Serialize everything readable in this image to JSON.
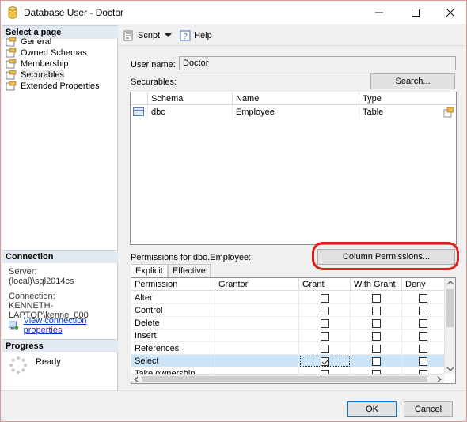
{
  "window": {
    "title": "Database User - Doctor"
  },
  "left_pane": {
    "select_page_heading": "Select a page",
    "pages": [
      {
        "label": "General"
      },
      {
        "label": "Owned Schemas"
      },
      {
        "label": "Membership"
      },
      {
        "label": "Securables",
        "selected": true
      },
      {
        "label": "Extended Properties"
      }
    ],
    "connection": {
      "heading": "Connection",
      "server_label": "Server:",
      "server_value": "(local)\\sql2014cs",
      "connection_label": "Connection:",
      "connection_value": "KENNETH-LAPTOP\\kenne_000",
      "view_link": "View connection properties"
    },
    "progress": {
      "heading": "Progress",
      "status": "Ready"
    }
  },
  "toolbar": {
    "script_label": "Script",
    "help_label": "Help"
  },
  "main": {
    "user_name_label": "User name:",
    "user_name_value": "Doctor",
    "securables_label": "Securables:",
    "search_button": "Search...",
    "securables_columns": [
      "Schema",
      "Name",
      "Type"
    ],
    "securables_rows": [
      {
        "schema": "dbo",
        "name": "Employee",
        "type": "Table"
      }
    ],
    "permissions_for_label": "Permissions for dbo.Employee:",
    "column_permissions_button": "Column Permissions...",
    "tabs": [
      "Explicit",
      "Effective"
    ],
    "active_tab": "Explicit",
    "permissions_columns": [
      "Permission",
      "Grantor",
      "Grant",
      "With Grant",
      "Deny"
    ],
    "permissions_rows": [
      {
        "permission": "Alter",
        "grantor": "",
        "grant": false,
        "with_grant": false,
        "deny": false
      },
      {
        "permission": "Control",
        "grantor": "",
        "grant": false,
        "with_grant": false,
        "deny": false
      },
      {
        "permission": "Delete",
        "grantor": "",
        "grant": false,
        "with_grant": false,
        "deny": false
      },
      {
        "permission": "Insert",
        "grantor": "",
        "grant": false,
        "with_grant": false,
        "deny": false
      },
      {
        "permission": "References",
        "grantor": "",
        "grant": false,
        "with_grant": false,
        "deny": false
      },
      {
        "permission": "Select",
        "grantor": "",
        "grant": true,
        "with_grant": false,
        "deny": false,
        "selected": true
      },
      {
        "permission": "Take ownership",
        "grantor": "",
        "grant": false,
        "with_grant": false,
        "deny": false
      }
    ]
  },
  "footer": {
    "ok_label": "OK",
    "cancel_label": "Cancel"
  },
  "colors": {
    "highlight_ring": "#e0201c",
    "selected_row": "#cce4f7",
    "link": "#0033cc"
  }
}
